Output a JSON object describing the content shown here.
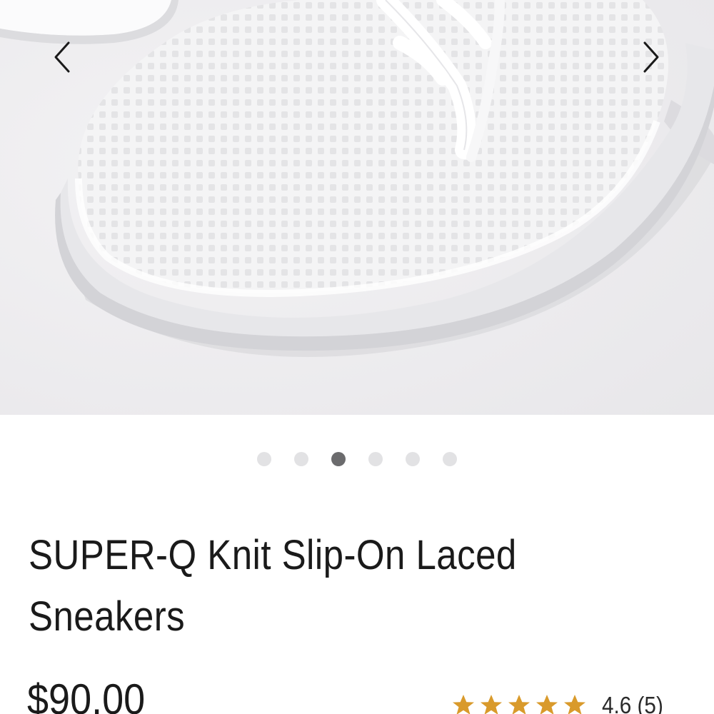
{
  "product": {
    "title": "SUPER-Q Knit Slip-On Laced Sneakers",
    "price": "$90.00",
    "rating_text": "4.6 (5)",
    "star_rating": 4.6,
    "star_count": 5
  },
  "carousel": {
    "image_name": "white-knit-sneaker-toe-closeup",
    "slide_count": 6,
    "active_slide": 3,
    "prev_icon": "chevron-left-icon",
    "next_icon": "chevron-right-icon"
  },
  "colors": {
    "image_background": "#efeef0",
    "dot_inactive": "#e2e2e4",
    "dot_active": "#6b6b6d",
    "star": "#d99a2b",
    "text": "#1a1a1a"
  }
}
